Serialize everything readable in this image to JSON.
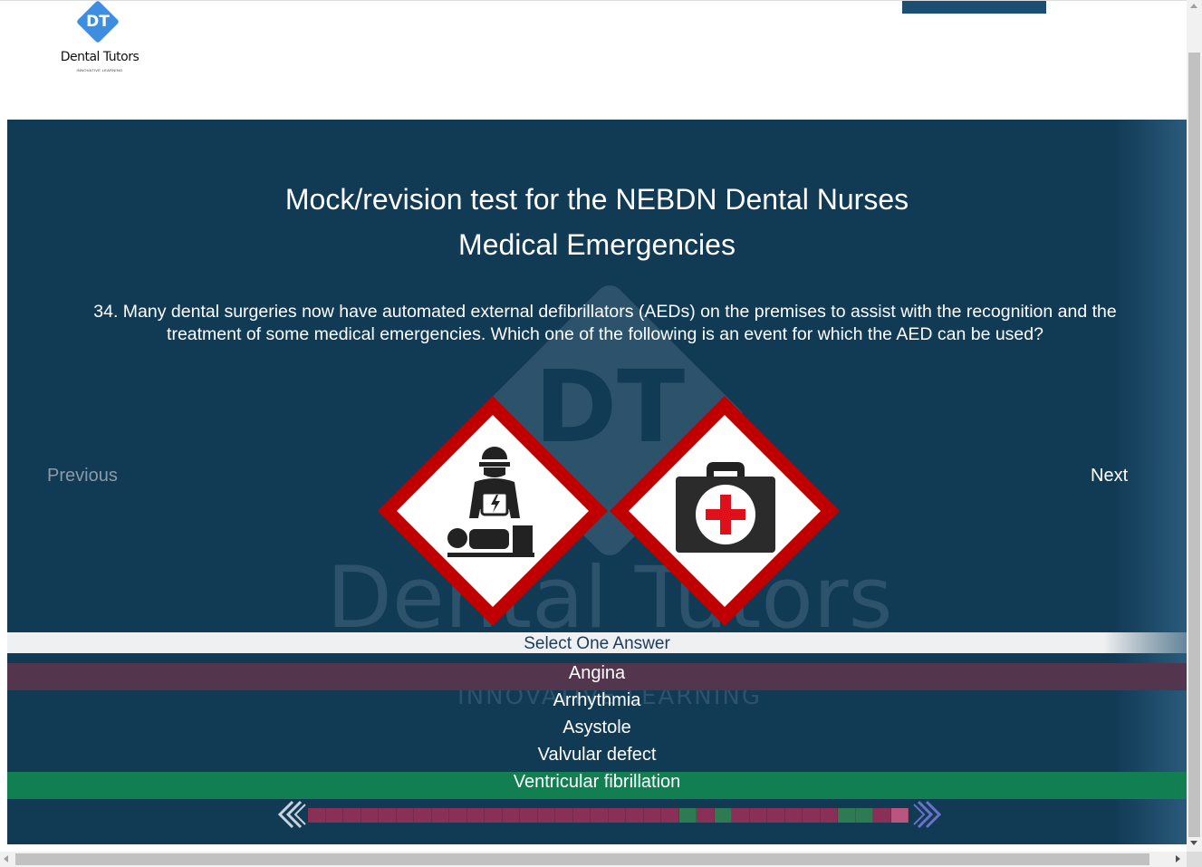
{
  "logo": {
    "initials": "DT",
    "brand": "Dental Tutors",
    "tagline": "INNOVATIVE LEARNING"
  },
  "watermark": {
    "initials": "DT",
    "brand": "Dental Tutors",
    "tagline": "INNOVATIVE LEARNING"
  },
  "header": {
    "title": "Mock/revision test for the NEBDN Dental Nurses",
    "subtitle": "Medical Emergencies"
  },
  "question": {
    "text": "34. Many dental surgeries now have automated external defibrillators (AEDs) on the premises to assist with the recognition and the treatment of some medical emergencies. Which one of the following is an event for which the AED can be used?"
  },
  "nav": {
    "previous": "Previous",
    "next": "Next"
  },
  "illustrations": [
    "defibrillator-sign-icon",
    "first-aid-kit-sign-icon"
  ],
  "answers": {
    "instruction": "Select One Answer",
    "options": [
      {
        "label": "Angina",
        "state": "wrong"
      },
      {
        "label": "Arrhythmia",
        "state": "none"
      },
      {
        "label": "Asystole",
        "state": "none"
      },
      {
        "label": "Valvular defect",
        "state": "none"
      },
      {
        "label": "Ventricular fibrillation",
        "state": "correct"
      }
    ]
  },
  "progress": {
    "results": [
      "w",
      "w",
      "w",
      "w",
      "w",
      "w",
      "w",
      "w",
      "w",
      "w",
      "w",
      "w",
      "w",
      "w",
      "w",
      "w",
      "w",
      "w",
      "w",
      "w",
      "w",
      "c",
      "w",
      "c",
      "w",
      "w",
      "w",
      "w",
      "w",
      "w",
      "c",
      "c",
      "w",
      "p"
    ],
    "colors": {
      "w": "#8a2f55",
      "c": "#2e7a52",
      "p": "#b9567f"
    }
  },
  "colors": {
    "panel": "#113a55",
    "wrong": "#53354d",
    "correct": "#117f52",
    "accent": "#3d8ee0",
    "sign_red": "#c00000"
  }
}
